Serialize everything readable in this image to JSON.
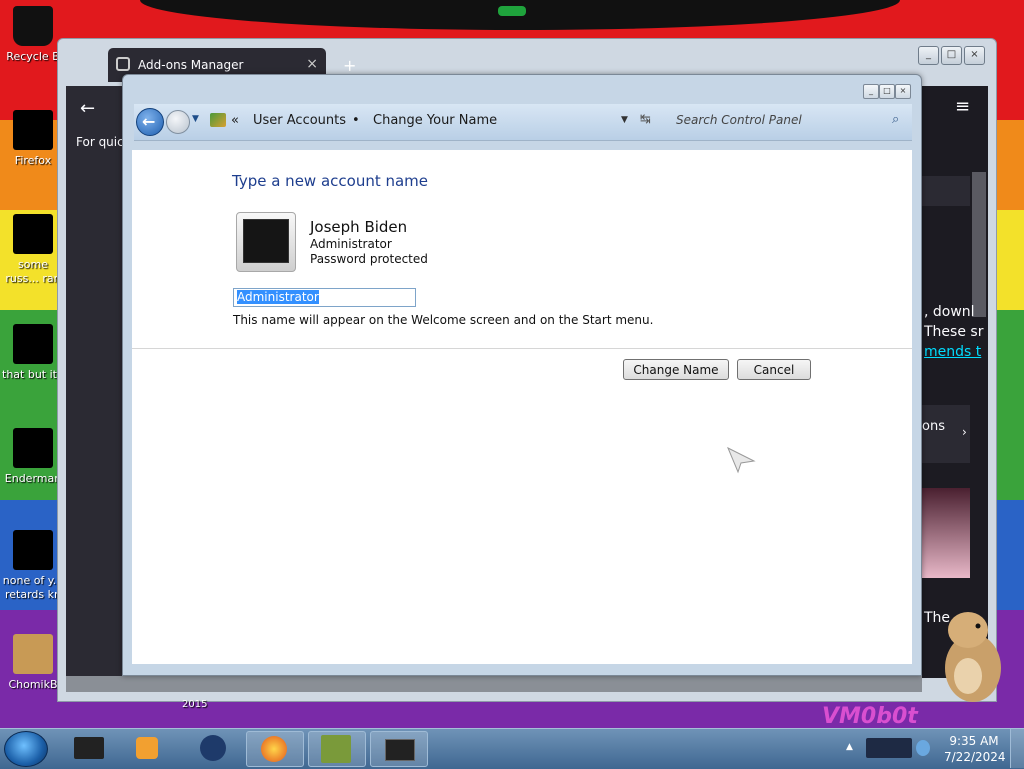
{
  "desktop": {
    "icons": [
      {
        "label": "Recycle B"
      },
      {
        "label": "Firefox"
      },
      {
        "label": "some russ... ran a re"
      },
      {
        "label": "that but it's"
      },
      {
        "label": "Enderman"
      },
      {
        "label": "none of y... retards kn"
      },
      {
        "label": "ChomikB"
      }
    ],
    "watermark": "VM0b0t"
  },
  "browser": {
    "tab_title": "Add-ons Manager",
    "tab_close": "×",
    "new_tab": "+",
    "back_arrow": "←",
    "for_quick": "For quick",
    "menu_icon": "≡",
    "right_snippets": {
      "line1": ", downl",
      "line2": "These sr",
      "line3": "mends t",
      "card1": "ons",
      "card2": "The"
    },
    "year_label": "2015"
  },
  "dialog": {
    "breadcrumb": {
      "sep_start": "«",
      "item1": "User Accounts",
      "sep": "•",
      "item2": "Change Your Name"
    },
    "search_placeholder": "Search Control Panel",
    "heading": "Type a new account name",
    "user": {
      "name": "Joseph Biden",
      "role": "Administrator",
      "protection": "Password protected"
    },
    "name_input_value": "Administrator",
    "hint": "This name will appear on the Welcome screen and on the Start menu.",
    "buttons": {
      "change_name": "Change Name",
      "cancel": "Cancel"
    }
  },
  "taskbar": {
    "time": "9:35 AM",
    "date": "7/22/2024"
  },
  "colors": {
    "heading_blue": "#1e3e8e",
    "selection": "#3390ff",
    "taskbar": "#4a7099"
  }
}
